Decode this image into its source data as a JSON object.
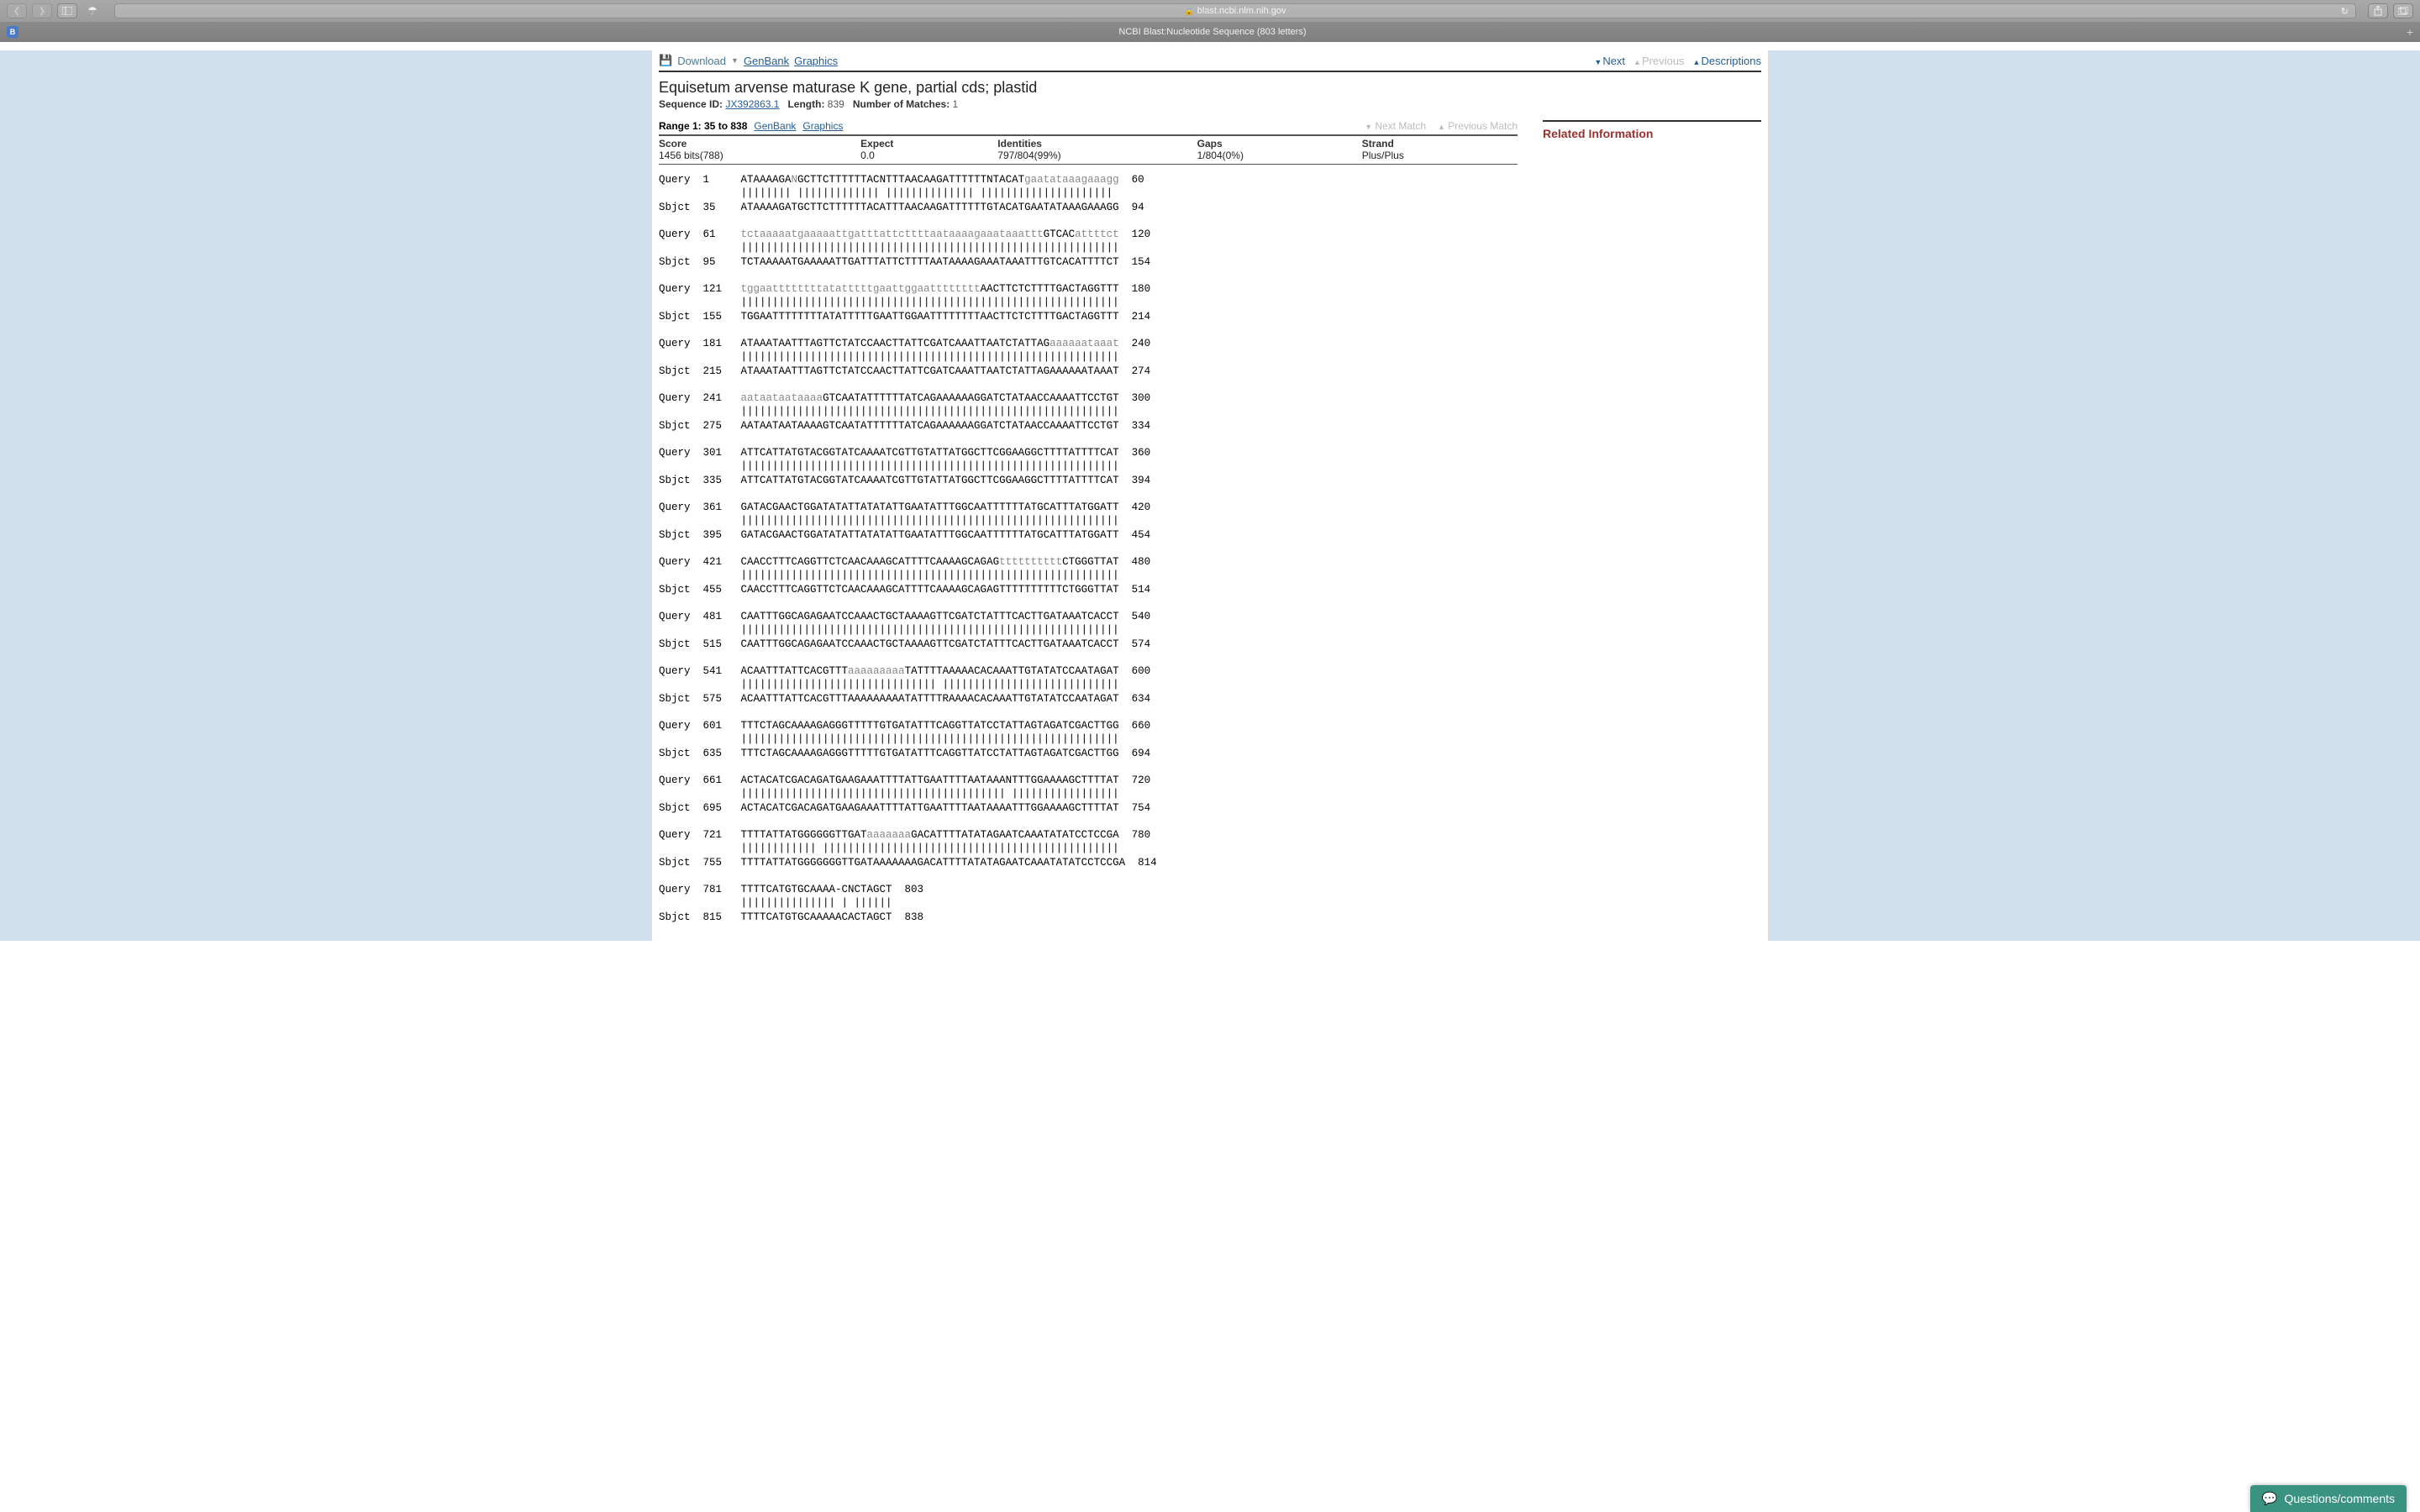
{
  "browser": {
    "url_host": "blast.ncbi.nlm.nih.gov",
    "tab_title": "NCBI Blast:Nucleotide Sequence (803 letters)"
  },
  "toolbar": {
    "download": "Download",
    "genbank": "GenBank",
    "graphics": "Graphics",
    "next": "Next",
    "previous": "Previous",
    "descriptions": "Descriptions"
  },
  "hit": {
    "title": "Equisetum arvense maturase K gene, partial cds; plastid",
    "seqid_label": "Sequence ID:",
    "seqid": "JX392863.1",
    "length_label": "Length:",
    "length": "839",
    "matches_label": "Number of Matches:",
    "matches": "1"
  },
  "related": {
    "heading": "Related Information"
  },
  "range_row": {
    "label": "Range 1: 35 to 838",
    "genbank": "GenBank",
    "graphics": "Graphics",
    "next_match": "Next Match",
    "prev_match": "Previous Match"
  },
  "stats": {
    "headers": [
      "Score",
      "Expect",
      "Identities",
      "Gaps",
      "Strand"
    ],
    "values": [
      "1456 bits(788)",
      "0.0",
      "797/804(99%)",
      "1/804(0%)",
      "Plus/Plus"
    ]
  },
  "alignment_rows": [
    {
      "type": "q",
      "label": "Query",
      "start": "1",
      "seq": [
        [
          "p",
          "ATAAAAGA"
        ],
        [
          "g",
          "N"
        ],
        [
          "p",
          "GCTTCTTTTTTACNTTTAACAAGATTTTTTNTACAT"
        ],
        [
          "g",
          "gaatataaagaaagg"
        ]
      ],
      "end": "60"
    },
    {
      "type": "m",
      "bars": "|||||||| ||||||||||||| |||||||||||||| |||||||||||||||||||||"
    },
    {
      "type": "s",
      "label": "Sbjct",
      "start": "35",
      "seq": [
        [
          "p",
          "ATAAAAGATGCTTCTTTTTTACATTTAACAAGATTTTTTGTACATGAATATAAAGAAAGG"
        ]
      ],
      "end": "94"
    },
    {
      "type": "gap"
    },
    {
      "type": "q",
      "label": "Query",
      "start": "61",
      "seq": [
        [
          "g",
          "tctaaaaatgaaaaattgatttattcttttaataaaagaaataaattt"
        ],
        [
          "p",
          "GTCAC"
        ],
        [
          "g",
          "attttct"
        ]
      ],
      "end": "120"
    },
    {
      "type": "m",
      "bars": "||||||||||||||||||||||||||||||||||||||||||||||||||||||||||||"
    },
    {
      "type": "s",
      "label": "Sbjct",
      "start": "95",
      "seq": [
        [
          "p",
          "TCTAAAAATGAAAAATTGATTTATTCTTTTAATAAAAGAAATAAATTTGTCACATTTTCT"
        ]
      ],
      "end": "154"
    },
    {
      "type": "gap"
    },
    {
      "type": "q",
      "label": "Query",
      "start": "121",
      "seq": [
        [
          "g",
          "tggaattttttttatatttttgaattggaatttttttt"
        ],
        [
          "p",
          "AACTTCTCTTTTGACTAGGTTT"
        ]
      ],
      "end": "180"
    },
    {
      "type": "m",
      "bars": "||||||||||||||||||||||||||||||||||||||||||||||||||||||||||||"
    },
    {
      "type": "s",
      "label": "Sbjct",
      "start": "155",
      "seq": [
        [
          "p",
          "TGGAATTTTTTTTATATTTTTGAATTGGAATTTTTTTTAACTTCTCTTTTGACTAGGTTT"
        ]
      ],
      "end": "214"
    },
    {
      "type": "gap"
    },
    {
      "type": "q",
      "label": "Query",
      "start": "181",
      "seq": [
        [
          "p",
          "ATAAATAATTTAGTTCTATCCAACTTATTCGATCAAATTAATCTATTAG"
        ],
        [
          "g",
          "aaaaaataaat"
        ]
      ],
      "end": "240"
    },
    {
      "type": "m",
      "bars": "||||||||||||||||||||||||||||||||||||||||||||||||||||||||||||"
    },
    {
      "type": "s",
      "label": "Sbjct",
      "start": "215",
      "seq": [
        [
          "p",
          "ATAAATAATTTAGTTCTATCCAACTTATTCGATCAAATTAATCTATTAGAAAAAATAAAT"
        ]
      ],
      "end": "274"
    },
    {
      "type": "gap"
    },
    {
      "type": "q",
      "label": "Query",
      "start": "241",
      "seq": [
        [
          "g",
          "aataataataaaa"
        ],
        [
          "p",
          "GTCAATATTTTTTATCAGAAAAAAGGATCTATAACCAAAATTCCTGT"
        ]
      ],
      "end": "300"
    },
    {
      "type": "m",
      "bars": "||||||||||||||||||||||||||||||||||||||||||||||||||||||||||||"
    },
    {
      "type": "s",
      "label": "Sbjct",
      "start": "275",
      "seq": [
        [
          "p",
          "AATAATAATAAAAGTCAATATTTTTTATCAGAAAAAAGGATCTATAACCAAAATTCCTGT"
        ]
      ],
      "end": "334"
    },
    {
      "type": "gap"
    },
    {
      "type": "q",
      "label": "Query",
      "start": "301",
      "seq": [
        [
          "p",
          "ATTCATTATGTACGGTATCAAAATCGTTGTATTATGGCTTCGGAAGGCTTTTATTTTCAT"
        ]
      ],
      "end": "360"
    },
    {
      "type": "m",
      "bars": "||||||||||||||||||||||||||||||||||||||||||||||||||||||||||||"
    },
    {
      "type": "s",
      "label": "Sbjct",
      "start": "335",
      "seq": [
        [
          "p",
          "ATTCATTATGTACGGTATCAAAATCGTTGTATTATGGCTTCGGAAGGCTTTTATTTTCAT"
        ]
      ],
      "end": "394"
    },
    {
      "type": "gap"
    },
    {
      "type": "q",
      "label": "Query",
      "start": "361",
      "seq": [
        [
          "p",
          "GATACGAACTGGATATATTATATATTGAATATTTGGCAATTTTTTATGCATTTATGGATT"
        ]
      ],
      "end": "420"
    },
    {
      "type": "m",
      "bars": "||||||||||||||||||||||||||||||||||||||||||||||||||||||||||||"
    },
    {
      "type": "s",
      "label": "Sbjct",
      "start": "395",
      "seq": [
        [
          "p",
          "GATACGAACTGGATATATTATATATTGAATATTTGGCAATTTTTTATGCATTTATGGATT"
        ]
      ],
      "end": "454"
    },
    {
      "type": "gap"
    },
    {
      "type": "q",
      "label": "Query",
      "start": "421",
      "seq": [
        [
          "p",
          "CAACCTTTCAGGTTCTCAACAAAGCATTTTCAAAAGCAGAG"
        ],
        [
          "g",
          "tttttttttt"
        ],
        [
          "p",
          "CTGGGTTAT"
        ]
      ],
      "end": "480"
    },
    {
      "type": "m",
      "bars": "||||||||||||||||||||||||||||||||||||||||||||||||||||||||||||"
    },
    {
      "type": "s",
      "label": "Sbjct",
      "start": "455",
      "seq": [
        [
          "p",
          "CAACCTTTCAGGTTCTCAACAAAGCATTTTCAAAAGCAGAGTTTTTTTTTTCTGGGTTAT"
        ]
      ],
      "end": "514"
    },
    {
      "type": "gap"
    },
    {
      "type": "q",
      "label": "Query",
      "start": "481",
      "seq": [
        [
          "p",
          "CAATTTGGCAGAGAATCCAAACTGCTAAAAGTTCGATCTATTTCACTTGATAAATCACCT"
        ]
      ],
      "end": "540"
    },
    {
      "type": "m",
      "bars": "||||||||||||||||||||||||||||||||||||||||||||||||||||||||||||"
    },
    {
      "type": "s",
      "label": "Sbjct",
      "start": "515",
      "seq": [
        [
          "p",
          "CAATTTGGCAGAGAATCCAAACTGCTAAAAGTTCGATCTATTTCACTTGATAAATCACCT"
        ]
      ],
      "end": "574"
    },
    {
      "type": "gap"
    },
    {
      "type": "q",
      "label": "Query",
      "start": "541",
      "seq": [
        [
          "p",
          "ACAATTTATTCACGTTT"
        ],
        [
          "g",
          "aaaaaaaaa"
        ],
        [
          "p",
          "TATTTTAAAAACACAAATTGTATATCCAATAGAT"
        ]
      ],
      "end": "600"
    },
    {
      "type": "m",
      "bars": "||||||||||||||||||||||||||||||| ||||||||||||||||||||||||||||"
    },
    {
      "type": "s",
      "label": "Sbjct",
      "start": "575",
      "seq": [
        [
          "p",
          "ACAATTTATTCACGTTTAAAAAAAAATATTTTRAAAACACAAATTGTATATCCAATAGAT"
        ]
      ],
      "end": "634"
    },
    {
      "type": "gap"
    },
    {
      "type": "q",
      "label": "Query",
      "start": "601",
      "seq": [
        [
          "p",
          "TTTCTAGCAAAAGAGGGTTTTTGTGATATTTCAGGTTATCCTATTAGTAGATCGACTTGG"
        ]
      ],
      "end": "660"
    },
    {
      "type": "m",
      "bars": "||||||||||||||||||||||||||||||||||||||||||||||||||||||||||||"
    },
    {
      "type": "s",
      "label": "Sbjct",
      "start": "635",
      "seq": [
        [
          "p",
          "TTTCTAGCAAAAGAGGGTTTTTGTGATATTTCAGGTTATCCTATTAGTAGATCGACTTGG"
        ]
      ],
      "end": "694"
    },
    {
      "type": "gap"
    },
    {
      "type": "q",
      "label": "Query",
      "start": "661",
      "seq": [
        [
          "p",
          "ACTACATCGACAGATGAAGAAATTTTATTGAATTTTAATAAANTTTGGAAAAGCTTTTAT"
        ]
      ],
      "end": "720"
    },
    {
      "type": "m",
      "bars": "|||||||||||||||||||||||||||||||||||||||||| |||||||||||||||||"
    },
    {
      "type": "s",
      "label": "Sbjct",
      "start": "695",
      "seq": [
        [
          "p",
          "ACTACATCGACAGATGAAGAAATTTTATTGAATTTTAATAAAATTTGGAAAAGCTTTTAT"
        ]
      ],
      "end": "754"
    },
    {
      "type": "gap"
    },
    {
      "type": "q",
      "label": "Query",
      "start": "721",
      "seq": [
        [
          "p",
          "TTTTATTATGGGGGGTTGAT"
        ],
        [
          "g",
          "aaaaaaa"
        ],
        [
          "p",
          "GACATTTTATATAGAATCAAATATATCCTCCGA"
        ]
      ],
      "end": "780"
    },
    {
      "type": "m",
      "bars": "|||||||||||| |||||||||||||||||||||||||||||||||||||||||||||||"
    },
    {
      "type": "s",
      "label": "Sbjct",
      "start": "755",
      "seq": [
        [
          "p",
          "TTTTATTATGGGGGGGTTGATAAAAAAAGACATTTTATATAGAATCAAATATATCCTCCGA"
        ]
      ],
      "end": "814"
    },
    {
      "type": "gap"
    },
    {
      "type": "q",
      "label": "Query",
      "start": "781",
      "seq": [
        [
          "p",
          "TTTTCATGTGCAAAA-CNCTAGCT"
        ]
      ],
      "end": "803"
    },
    {
      "type": "m",
      "bars": "||||||||||||||| | ||||||"
    },
    {
      "type": "s",
      "label": "Sbjct",
      "start": "815",
      "seq": [
        [
          "p",
          "TTTTCATGTGCAAAAACACTAGCT"
        ]
      ],
      "end": "838"
    }
  ],
  "questions_btn": "Questions/comments"
}
